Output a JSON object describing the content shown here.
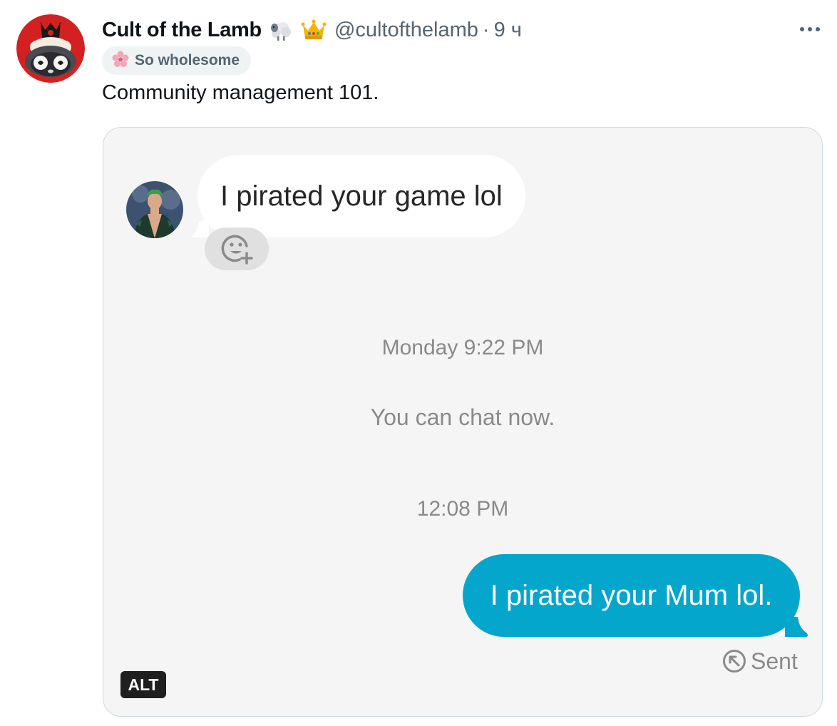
{
  "author": {
    "display_name": "Cult of the Lamb",
    "handle": "@cultofthelamb",
    "separator": "·",
    "time": "9 ч",
    "avatar_icon": "cult-of-the-lamb-avatar",
    "name_emojis": [
      "sheep-emoji",
      "crown-emoji"
    ]
  },
  "label": {
    "icon": "cherry-blossom-icon",
    "text": "So wholesome"
  },
  "tweet": {
    "text": "Community management 101."
  },
  "media": {
    "incoming_message": "I pirated your game lol",
    "timestamp_1": "Monday 9:22 PM",
    "system_notice": "You can chat now.",
    "timestamp_2": "12:08 PM",
    "outgoing_message": "I pirated your Mum lol.",
    "status": "Sent",
    "alt_badge": "ALT"
  },
  "colors": {
    "outgoing_bubble": "#05a6cc",
    "media_background": "#f5f5f5",
    "avatar_red": "#d32121",
    "secondary_text": "#536471"
  }
}
